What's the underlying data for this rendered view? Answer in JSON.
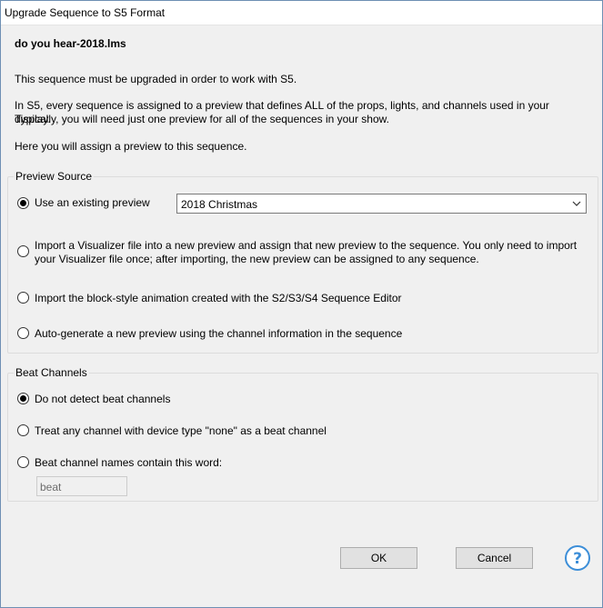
{
  "window": {
    "title": "Upgrade Sequence to S5 Format"
  },
  "filename": "do you hear-2018.lms",
  "intro": {
    "p1": "This sequence must be upgraded in order to work with S5.",
    "p2_line1": "In S5, every sequence is assigned to a preview that defines ALL of the props, lights, and channels used in your display.",
    "p2_line2": "Typically, you will need just one preview for all of the sequences in your show.",
    "p3": "Here you will assign a preview to this sequence."
  },
  "preview_source": {
    "label": "Preview Source",
    "options": [
      {
        "label": "Use an existing preview",
        "checked": true
      },
      {
        "label_line1": "Import a Visualizer file into a new preview and assign that new preview to the sequence. You only need to import",
        "label_line2": "your Visualizer file once; after importing, the new preview can be assigned to any sequence.",
        "checked": false
      },
      {
        "label": "Import the block-style animation created with the S2/S3/S4 Sequence Editor",
        "checked": false
      },
      {
        "label": "Auto-generate a new preview using the channel information in the sequence",
        "checked": false
      }
    ],
    "selected_preview": "2018 Christmas"
  },
  "beat_channels": {
    "label": "Beat Channels",
    "options": [
      {
        "label": "Do not detect beat channels",
        "checked": true
      },
      {
        "label": "Treat any channel with device type \"none\" as a beat channel",
        "checked": false
      },
      {
        "label": "Beat channel names contain this word:",
        "checked": false
      }
    ],
    "word_value": "beat"
  },
  "buttons": {
    "ok": "OK",
    "cancel": "Cancel"
  },
  "icons": {
    "help": "help-icon",
    "dropdown": "chevron-down-icon"
  },
  "colors": {
    "help_accent": "#3c8ed8",
    "border": "#dcdcdc"
  }
}
